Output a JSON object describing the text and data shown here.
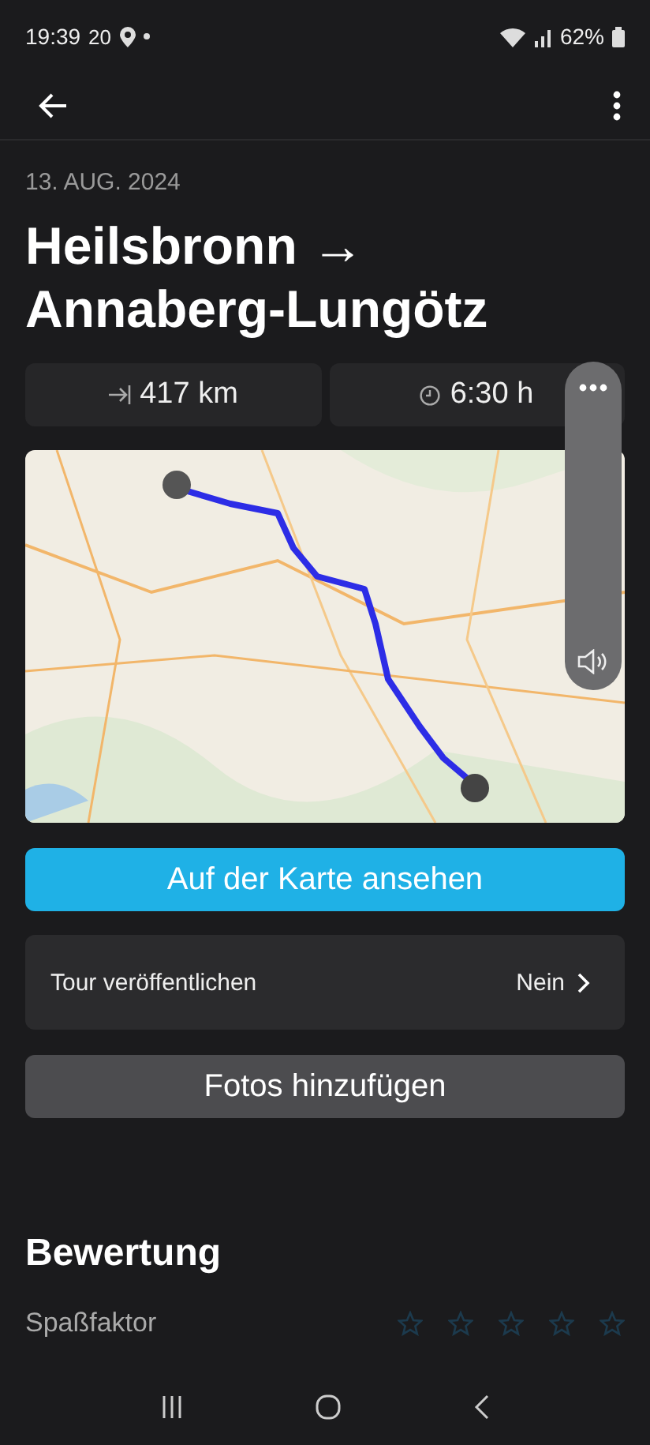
{
  "status_bar": {
    "time": "19:39",
    "temperature": "20",
    "battery": "62%"
  },
  "tour": {
    "date": "13. AUG. 2024",
    "title": "Heilsbronn → Annaberg-Lungötz",
    "distance": "417 km",
    "duration": "6:30 h"
  },
  "buttons": {
    "view_on_map": "Auf der Karte ansehen",
    "add_photos": "Fotos hinzufügen"
  },
  "publish": {
    "label": "Tour veröffentlichen",
    "value": "Nein"
  },
  "rating": {
    "title": "Bewertung",
    "criteria": [
      {
        "label": "Spaßfaktor",
        "stars": 0
      }
    ]
  }
}
